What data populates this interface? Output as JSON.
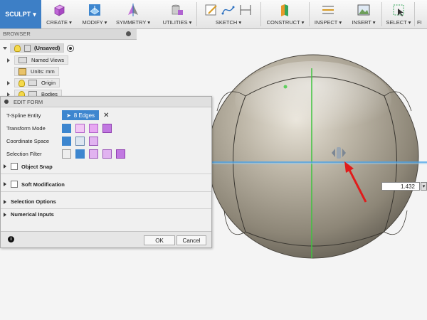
{
  "toolbar": {
    "workspace": "SCULPT",
    "groups": [
      {
        "label": "CREATE"
      },
      {
        "label": "MODIFY"
      },
      {
        "label": "SYMMETRY"
      },
      {
        "label": "UTILITIES"
      },
      {
        "label": "SKETCH"
      },
      {
        "label": "CONSTRUCT"
      },
      {
        "label": "INSPECT"
      },
      {
        "label": "INSERT"
      },
      {
        "label": "SELECT"
      },
      {
        "label": "FI"
      }
    ]
  },
  "browser": {
    "title": "BROWSER",
    "root": "(Unsaved)",
    "items": [
      "Named Views",
      "Units: mm",
      "Origin",
      "Bodies"
    ]
  },
  "edit_form": {
    "title": "EDIT FORM",
    "tspline_label": "T-Spline Entity",
    "tspline_value": "8 Edges",
    "transform_label": "Transform Mode",
    "coord_label": "Coordinate Space",
    "filter_label": "Selection Filter",
    "object_snap": "Object Snap",
    "soft_mod": "Soft Modification",
    "sel_options": "Selection Options",
    "num_inputs": "Numerical Inputs",
    "ok": "OK",
    "cancel": "Cancel"
  },
  "viewport": {
    "dimension_value": "1.432"
  }
}
